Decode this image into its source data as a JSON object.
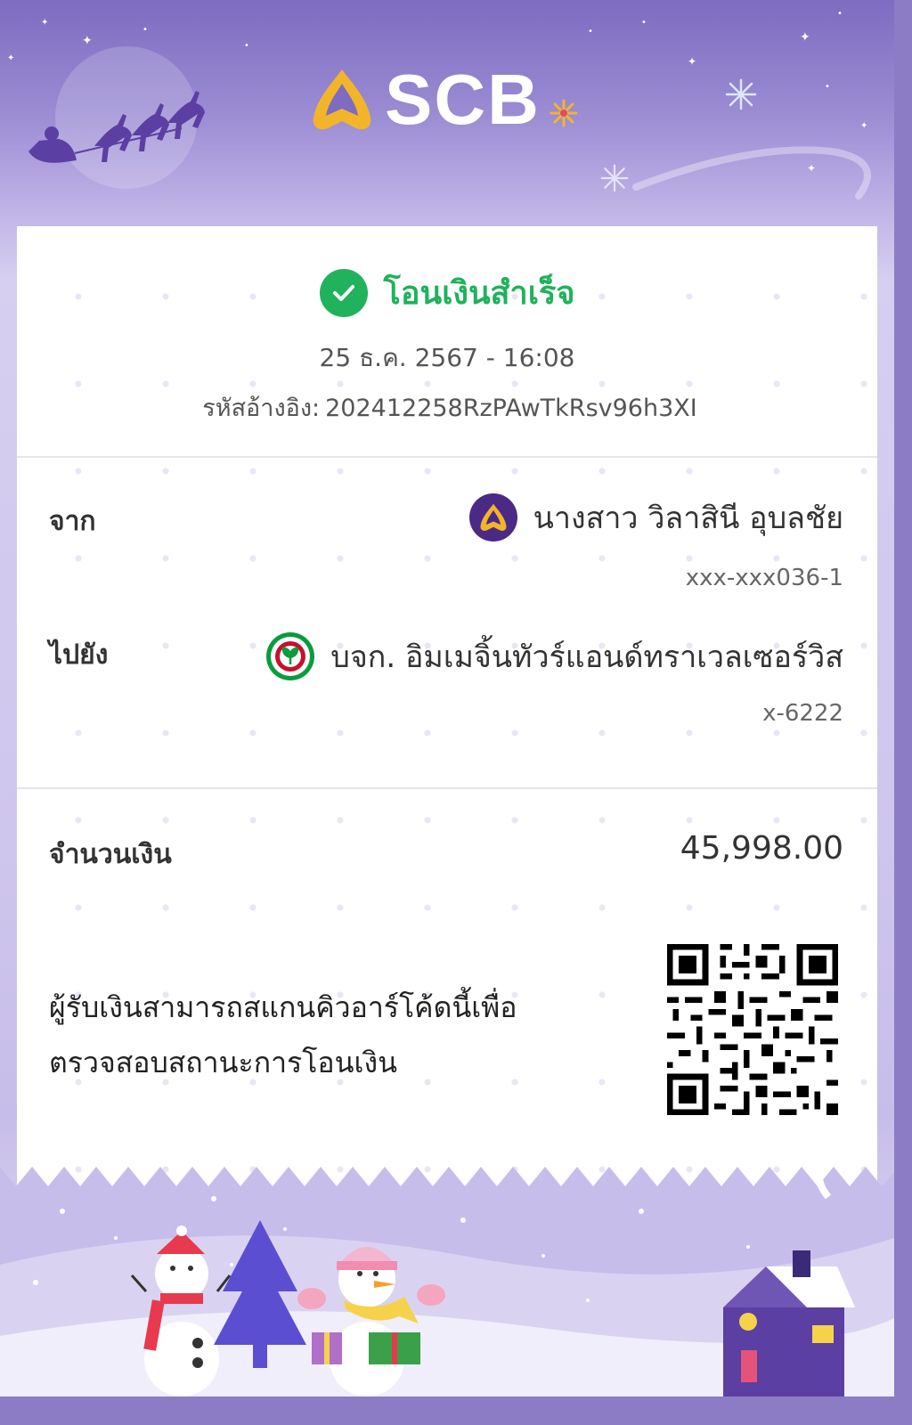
{
  "brand": {
    "name": "SCB"
  },
  "status": {
    "text": "โอนเงินสำเร็จ"
  },
  "transaction": {
    "datetime": "25 ธ.ค. 2567 - 16:08",
    "ref_label": "รหัสอ้างอิง:",
    "ref_value": "202412258RzPAwTkRsv96h3XI"
  },
  "from": {
    "label": "จาก",
    "name": "นางสาว วิลาสินี อุบลชัย",
    "account": "xxx-xxx036-1",
    "bank_icon": "scb-bank-icon",
    "bank_color": "#4b2a85"
  },
  "to": {
    "label": "ไปยัง",
    "name": "บจก. อิมเมจิ้นทัวร์แอนด์ทราเวลเซอร์วิส",
    "account": "x-6222",
    "bank_icon": "kbank-bank-icon",
    "bank_color": "#0a9c3c"
  },
  "amount": {
    "label": "จำนวนเงิน",
    "value": "45,998.00"
  },
  "qr": {
    "line1": "ผู้รับเงินสามารถสแกนคิวอาร์โค้ดนี้เพื่อ",
    "line2": "ตรวจสอบสถานะการโอนเงิน"
  },
  "colors": {
    "success": "#21b35b",
    "header": "#7d6cc0",
    "gold": "#f2b52a"
  }
}
